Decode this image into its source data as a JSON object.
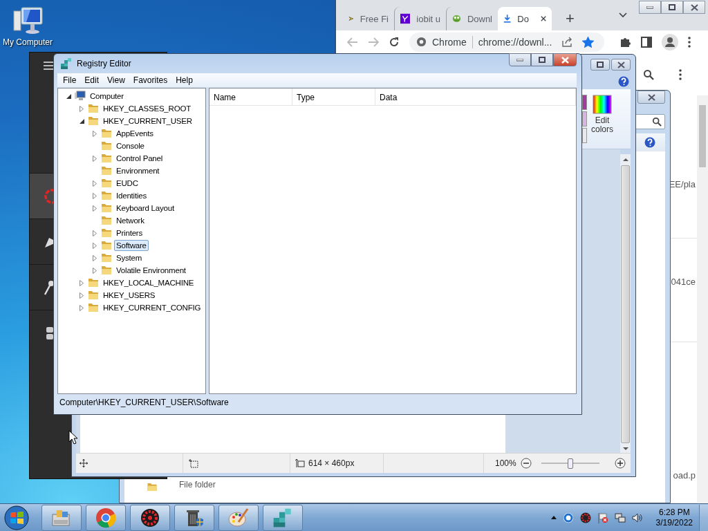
{
  "desktop_icons": [
    {
      "label": "My Computer"
    }
  ],
  "browser": {
    "tabs": [
      {
        "title": "Free Fi",
        "selected": false
      },
      {
        "title": "iobit u",
        "selected": false
      },
      {
        "title": "Downl",
        "selected": false
      },
      {
        "title": "Do",
        "selected": true
      }
    ],
    "new_tab": "+",
    "omnibox": {
      "chip": "Chrome",
      "url": "chrome://downl..."
    },
    "bookmarked": true,
    "page_fragments": [
      "EE/pla",
      "041ce",
      "oad.p"
    ]
  },
  "file_explorer": {
    "rows": [
      {
        "type": "File folder"
      }
    ]
  },
  "app_sidebar": [
    {
      "selected": true
    },
    {
      "selected": false
    },
    {
      "selected": false
    },
    {
      "selected": false
    }
  ],
  "paint": {
    "edit_colors": "Edit colors",
    "status_bar": {
      "image_size": "614 × 460px",
      "zoom": "100%",
      "zoom_slider": {
        "level": 0.5
      }
    }
  },
  "registry_editor": {
    "title": "Registry Editor",
    "menu": [
      "File",
      "Edit",
      "View",
      "Favorites",
      "Help"
    ],
    "tree": [
      {
        "label": "Computer",
        "kind": "computer",
        "expandable": true,
        "expanded": true,
        "selected": false,
        "children": [
          {
            "label": "HKEY_CLASSES_ROOT",
            "kind": "folder",
            "expandable": true,
            "expanded": false,
            "selected": false
          },
          {
            "label": "HKEY_CURRENT_USER",
            "kind": "folder",
            "expandable": true,
            "expanded": true,
            "selected": false,
            "children": [
              {
                "label": "AppEvents",
                "kind": "folder",
                "expandable": true,
                "expanded": false,
                "selected": false
              },
              {
                "label": "Console",
                "kind": "folder",
                "expandable": false,
                "selected": false
              },
              {
                "label": "Control Panel",
                "kind": "folder",
                "expandable": true,
                "expanded": false,
                "selected": false
              },
              {
                "label": "Environment",
                "kind": "folder",
                "expandable": false,
                "selected": false
              },
              {
                "label": "EUDC",
                "kind": "folder",
                "expandable": true,
                "expanded": false,
                "selected": false
              },
              {
                "label": "Identities",
                "kind": "folder",
                "expandable": true,
                "expanded": false,
                "selected": false
              },
              {
                "label": "Keyboard Layout",
                "kind": "folder",
                "expandable": true,
                "expanded": false,
                "selected": false
              },
              {
                "label": "Network",
                "kind": "folder",
                "expandable": false,
                "selected": false
              },
              {
                "label": "Printers",
                "kind": "folder",
                "expandable": true,
                "expanded": false,
                "selected": false
              },
              {
                "label": "Software",
                "kind": "folder",
                "expandable": true,
                "expanded": false,
                "selected": true
              },
              {
                "label": "System",
                "kind": "folder",
                "expandable": true,
                "expanded": false,
                "selected": false
              },
              {
                "label": "Volatile Environment",
                "kind": "folder",
                "expandable": true,
                "expanded": false,
                "selected": false
              }
            ]
          },
          {
            "label": "HKEY_LOCAL_MACHINE",
            "kind": "folder",
            "expandable": true,
            "expanded": false,
            "selected": false
          },
          {
            "label": "HKEY_USERS",
            "kind": "folder",
            "expandable": true,
            "expanded": false,
            "selected": false
          },
          {
            "label": "HKEY_CURRENT_CONFIG",
            "kind": "folder",
            "expandable": true,
            "expanded": false,
            "selected": false
          }
        ]
      }
    ],
    "columns": [
      "Name",
      "Type",
      "Data"
    ],
    "status_bar": "Computer\\HKEY_CURRENT_USER\\Software"
  },
  "taskbar": {
    "apps": [
      {
        "kind": "explorer"
      },
      {
        "kind": "chrome"
      },
      {
        "kind": "gear"
      },
      {
        "kind": "bin"
      },
      {
        "kind": "paint"
      },
      {
        "kind": "cubes"
      }
    ],
    "tray": [
      {
        "kind": "up"
      },
      {
        "kind": "ring"
      },
      {
        "kind": "gear"
      },
      {
        "kind": "flag"
      },
      {
        "kind": "network"
      },
      {
        "kind": "speaker"
      }
    ],
    "clock": {
      "time": "6:28 PM",
      "date": "3/19/2022"
    }
  }
}
